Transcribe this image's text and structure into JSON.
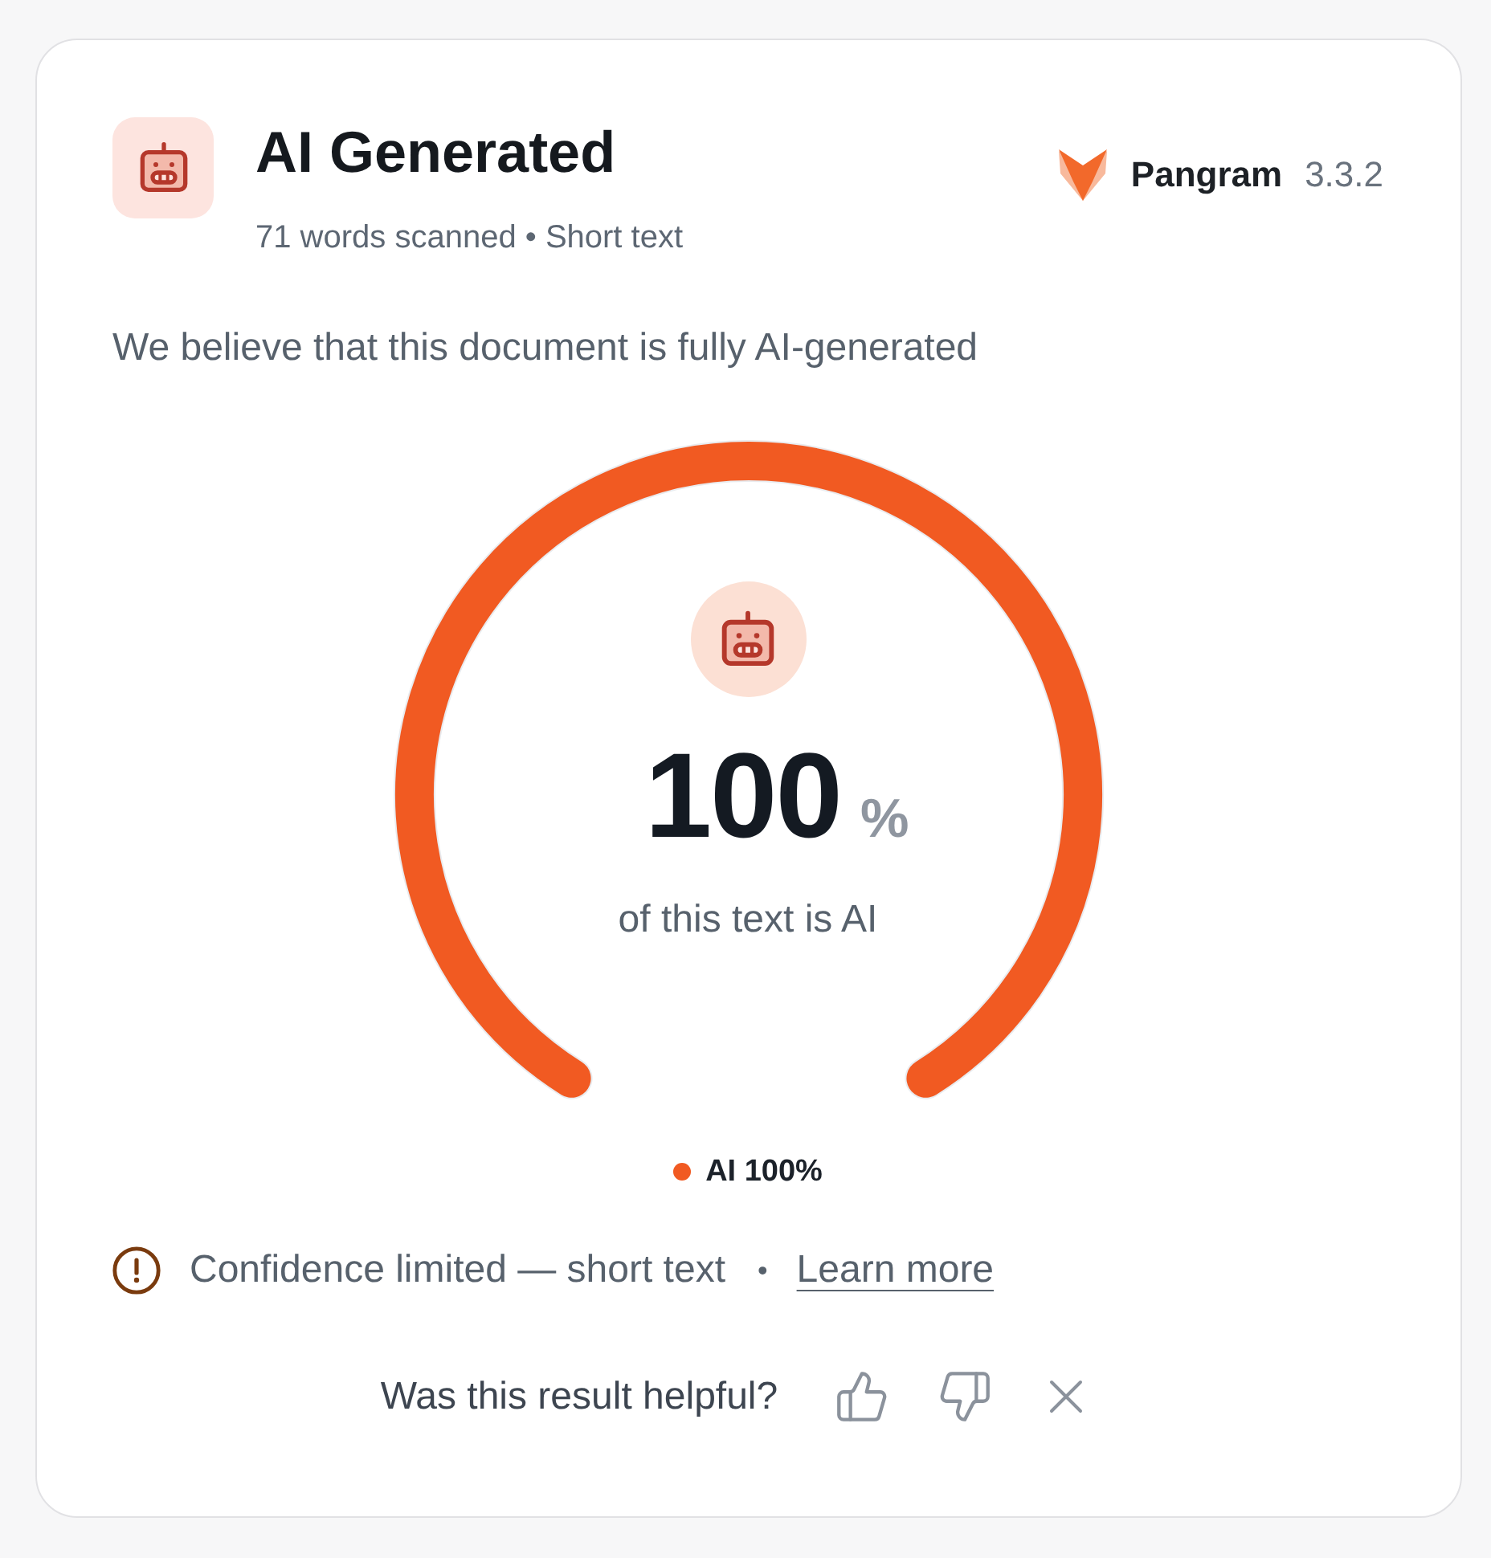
{
  "header": {
    "title": "AI Generated",
    "subtitle": "71 words scanned • Short text"
  },
  "brand": {
    "name": "Pangram",
    "version": "3.3.2"
  },
  "summary": "We believe that this document is fully AI-generated",
  "gauge": {
    "level": 1,
    "value": "100",
    "unit": "%",
    "caption": "of this text is AI"
  },
  "legend": [
    {
      "label": "AI 100%",
      "color": "#f15a22"
    }
  ],
  "notice": {
    "text": "Confidence limited — short text",
    "separator": "•",
    "link": "Learn more"
  },
  "feedback": {
    "question": "Was this result helpful?"
  }
}
